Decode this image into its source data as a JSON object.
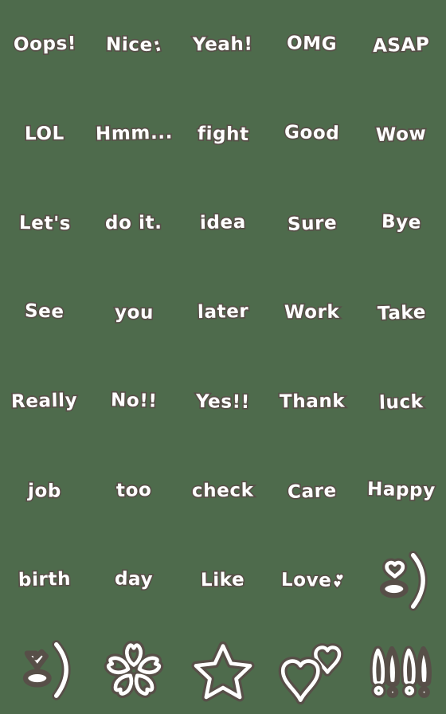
{
  "sheet": {
    "title": "Handwritten English Word Emoji Sticker Sheet",
    "background_color": "#4e6b4c",
    "glyph_color": "#ffffff",
    "outline_color": "#574f48",
    "columns": 5,
    "rows": 8,
    "item_count": 40
  },
  "stickers": [
    {
      "id": "r1c1",
      "type": "text",
      "label": "Oops!"
    },
    {
      "id": "r1c2",
      "type": "text",
      "label": "Nice",
      "suffix": ":"
    },
    {
      "id": "r1c3",
      "type": "text",
      "label": "Yeah!"
    },
    {
      "id": "r1c4",
      "type": "text",
      "label": "OMG"
    },
    {
      "id": "r1c5",
      "type": "text",
      "label": "ASAP"
    },
    {
      "id": "r2c1",
      "type": "text",
      "label": "LOL"
    },
    {
      "id": "r2c2",
      "type": "text",
      "label": "Hmm..."
    },
    {
      "id": "r2c3",
      "type": "text",
      "label": "fight"
    },
    {
      "id": "r2c4",
      "type": "text",
      "label": "Good"
    },
    {
      "id": "r2c5",
      "type": "text",
      "label": "Wow"
    },
    {
      "id": "r3c1",
      "type": "text",
      "label": "Let's"
    },
    {
      "id": "r3c2",
      "type": "text",
      "label": "do it."
    },
    {
      "id": "r3c3",
      "type": "text",
      "label": "idea"
    },
    {
      "id": "r3c4",
      "type": "text",
      "label": "Sure"
    },
    {
      "id": "r3c5",
      "type": "text",
      "label": "Bye"
    },
    {
      "id": "r4c1",
      "type": "text",
      "label": "See"
    },
    {
      "id": "r4c2",
      "type": "text",
      "label": "you"
    },
    {
      "id": "r4c3",
      "type": "text",
      "label": "later"
    },
    {
      "id": "r4c4",
      "type": "text",
      "label": "Work"
    },
    {
      "id": "r4c5",
      "type": "text",
      "label": "Take"
    },
    {
      "id": "r5c1",
      "type": "text",
      "label": "Really"
    },
    {
      "id": "r5c2",
      "type": "text",
      "label": "No!!"
    },
    {
      "id": "r5c3",
      "type": "text",
      "label": "Yes!!"
    },
    {
      "id": "r5c4",
      "type": "text",
      "label": "Thank"
    },
    {
      "id": "r5c5",
      "type": "text",
      "label": "luck"
    },
    {
      "id": "r6c1",
      "type": "text",
      "label": "job"
    },
    {
      "id": "r6c2",
      "type": "text",
      "label": "too"
    },
    {
      "id": "r6c3",
      "type": "text",
      "label": "check"
    },
    {
      "id": "r6c4",
      "type": "text",
      "label": "Care"
    },
    {
      "id": "r6c5",
      "type": "text",
      "label": "Happy"
    },
    {
      "id": "r7c1",
      "type": "text",
      "label": "birth"
    },
    {
      "id": "r7c2",
      "type": "text",
      "label": "day"
    },
    {
      "id": "r7c3",
      "type": "text",
      "label": "Like"
    },
    {
      "id": "r7c4",
      "type": "text",
      "label": "Love",
      "hearts": [
        "♥",
        "♥"
      ]
    },
    {
      "id": "r7c5",
      "type": "icon",
      "icon": "face-heart-eye-smile",
      "label": "heart eye smiling face"
    },
    {
      "id": "r8c1",
      "type": "icon",
      "icon": "face-arrow-eye-smile",
      "label": "arrow eye smiling face"
    },
    {
      "id": "r8c2",
      "type": "icon",
      "icon": "cherry-blossom",
      "label": "cherry blossom"
    },
    {
      "id": "r8c3",
      "type": "icon",
      "icon": "star-outline",
      "label": "star"
    },
    {
      "id": "r8c4",
      "type": "icon",
      "icon": "double-heart-outline",
      "label": "double hearts"
    },
    {
      "id": "r8c5",
      "type": "icon",
      "icon": "four-exclamations",
      "label": "four exclamation marks"
    }
  ]
}
